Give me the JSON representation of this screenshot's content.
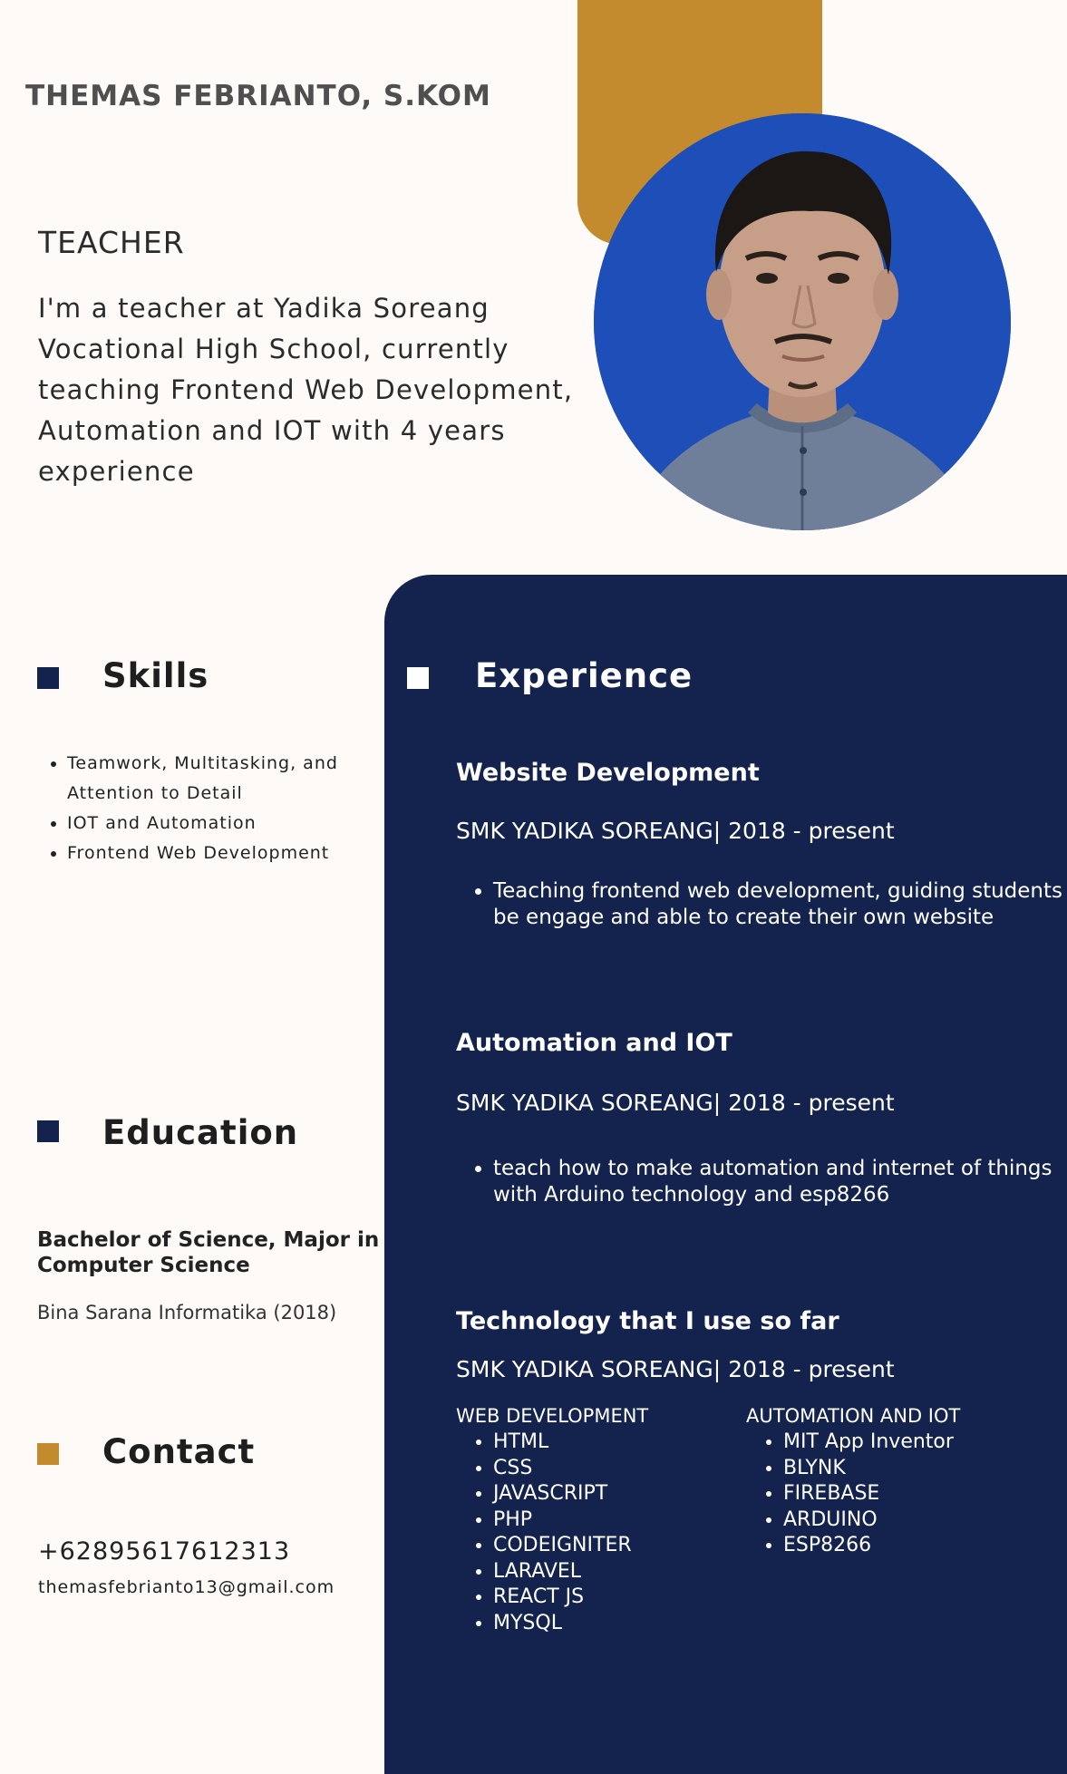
{
  "header": {
    "name": "THEMAS FEBRIANTO, S.KOM",
    "role": "TEACHER",
    "bio": "I'm a teacher at Yadika Soreang Vocational High School, currently teaching Frontend Web Development, Automation and IOT with 4 years experience"
  },
  "skills": {
    "title": "Skills",
    "items": [
      "Teamwork, Multitasking, and Attention to Detail",
      "IOT and Automation",
      "Frontend Web   Development"
    ]
  },
  "education": {
    "title": "Education",
    "degree": "Bachelor of Science, Major in Computer Science",
    "school": "Bina Sarana Informatika (2018)"
  },
  "contact": {
    "title": "Contact",
    "phone": "+62895617612313",
    "email": "themasfebrianto13@gmail.com"
  },
  "experience": {
    "title": "Experience",
    "jobs": [
      {
        "title": "Website Development",
        "org": "SMK YADIKA SOREANG| 2018 - present",
        "bullets": [
          "Teaching frontend web development, guiding students to be engage and able to create their own website"
        ]
      },
      {
        "title": "Automation and IOT",
        "org": "SMK YADIKA SOREANG| 2018 - present",
        "bullets": [
          "teach how to make automation and internet of things with Arduino technology and esp8266"
        ]
      }
    ],
    "tech": {
      "title": "Technology that I use so far",
      "org": "SMK YADIKA SOREANG| 2018 - present",
      "web_title": "WEB DEVELOPMENT",
      "web_items": [
        "HTML",
        "CSS",
        "JAVASCRIPT",
        "PHP",
        "CODEIGNITER",
        "LARAVEL",
        "REACT JS",
        "MYSQL"
      ],
      "iot_title": "AUTOMATION AND IOT",
      "iot_items": [
        "MIT App Inventor",
        "BLYNK",
        "FIREBASE",
        "ARDUINO",
        "ESP8266"
      ]
    }
  },
  "colors": {
    "accent_gold": "#c38b2d",
    "navy": "#13234d",
    "background": "#fdfaf7"
  }
}
